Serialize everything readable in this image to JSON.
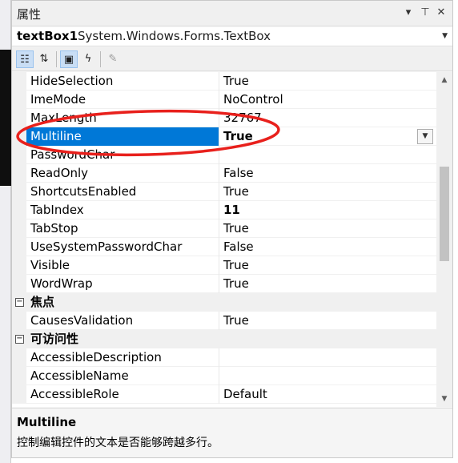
{
  "window": {
    "title": "属性"
  },
  "selector": {
    "name": "textBox1",
    "type": "System.Windows.Forms.TextBox"
  },
  "properties": [
    {
      "name": "HideSelection",
      "value": "True"
    },
    {
      "name": "ImeMode",
      "value": "NoControl"
    },
    {
      "name": "MaxLength",
      "value": "32767"
    },
    {
      "name": "Multiline",
      "value": "True"
    },
    {
      "name": "PasswordChar",
      "value": ""
    },
    {
      "name": "ReadOnly",
      "value": "False"
    },
    {
      "name": "ShortcutsEnabled",
      "value": "True"
    },
    {
      "name": "TabIndex",
      "value": "11"
    },
    {
      "name": "TabStop",
      "value": "True"
    },
    {
      "name": "UseSystemPasswordChar",
      "value": "False"
    },
    {
      "name": "Visible",
      "value": "True"
    },
    {
      "name": "WordWrap",
      "value": "True"
    }
  ],
  "focus_category": {
    "label": "焦点",
    "toggle": "−"
  },
  "focus_properties": [
    {
      "name": "CausesValidation",
      "value": "True"
    }
  ],
  "access_category": {
    "label": "可访问性",
    "toggle": "−"
  },
  "access_properties": [
    {
      "name": "AccessibleDescription",
      "value": ""
    },
    {
      "name": "AccessibleName",
      "value": ""
    },
    {
      "name": "AccessibleRole",
      "value": "Default"
    }
  ],
  "description": {
    "title": "Multiline",
    "text": "控制编辑控件的文本是否能够跨越多行。"
  },
  "colors": {
    "selection": "#0078d7",
    "annotation": "#e8201c"
  }
}
